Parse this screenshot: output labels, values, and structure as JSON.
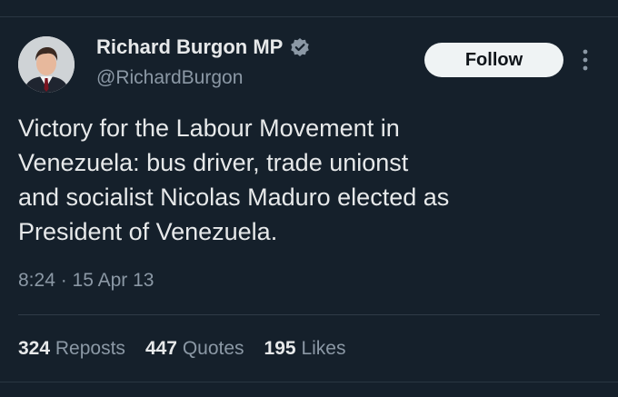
{
  "author": {
    "display_name": "Richard Burgon MP",
    "handle": "@RichardBurgon",
    "verified_icon": "verified-badge-icon",
    "verified_color": "#1d9bf0"
  },
  "actions": {
    "follow_label": "Follow",
    "more_icon": "more-vertical-icon"
  },
  "tweet": {
    "lines": [
      "Victory for the Labour Movement in",
      "Venezuela: bus driver, trade unionst",
      "and socialist Nicolas Maduro elected as",
      "President of Venezuela."
    ],
    "timestamp": "8:24 · 15 Apr 13"
  },
  "stats": {
    "reposts": {
      "count": "324",
      "label": "Reposts"
    },
    "quotes": {
      "count": "447",
      "label": "Quotes"
    },
    "likes": {
      "count": "195",
      "label": "Likes"
    }
  },
  "colors": {
    "background": "#15202b",
    "text_primary": "#e7e9ea",
    "text_secondary": "#8b98a5",
    "button_bg": "#eff3f4"
  }
}
